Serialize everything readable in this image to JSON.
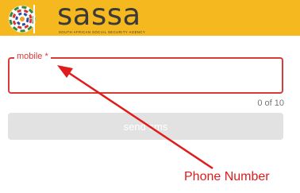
{
  "header": {
    "brand": "sassa",
    "tagline": "SOUTH AFRICAN SOCIAL SECURITY AGENCY",
    "background_color": "#f5b81f"
  },
  "form": {
    "mobile_label": "mobile *",
    "mobile_value": "",
    "counter": "0 of 10",
    "send_button_label": "send sms",
    "accent_color": "#d93b3b"
  },
  "annotation": {
    "text": "Phone Number",
    "color": "#e01b1b"
  }
}
